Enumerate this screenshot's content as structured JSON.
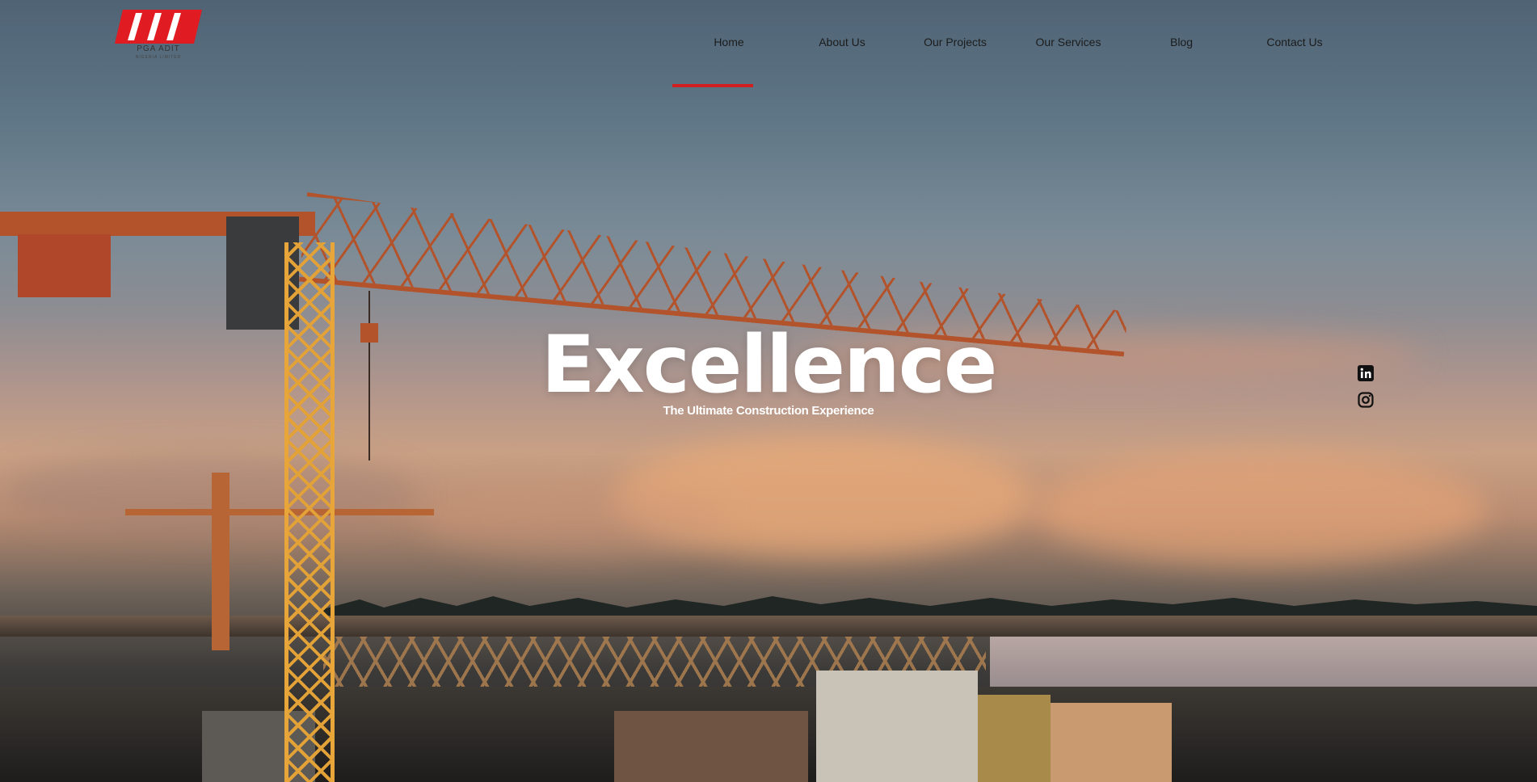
{
  "brand": {
    "name": "PGA ADIT",
    "tagline": "NIGERIA LIMITED",
    "accent_color": "#d11f1f"
  },
  "nav": {
    "items": [
      {
        "label": "Home",
        "active": true
      },
      {
        "label": "About Us",
        "active": false
      },
      {
        "label": "Our Projects",
        "active": false
      },
      {
        "label": "Our Services",
        "active": false
      },
      {
        "label": "Blog",
        "active": false
      },
      {
        "label": "Contact Us",
        "active": false
      }
    ]
  },
  "hero": {
    "title": "Excellence",
    "subtitle": "The Ultimate Construction Experience",
    "background": "crane-at-sunset-photo"
  },
  "social": {
    "icons": [
      "linkedin-icon",
      "instagram-icon"
    ]
  }
}
